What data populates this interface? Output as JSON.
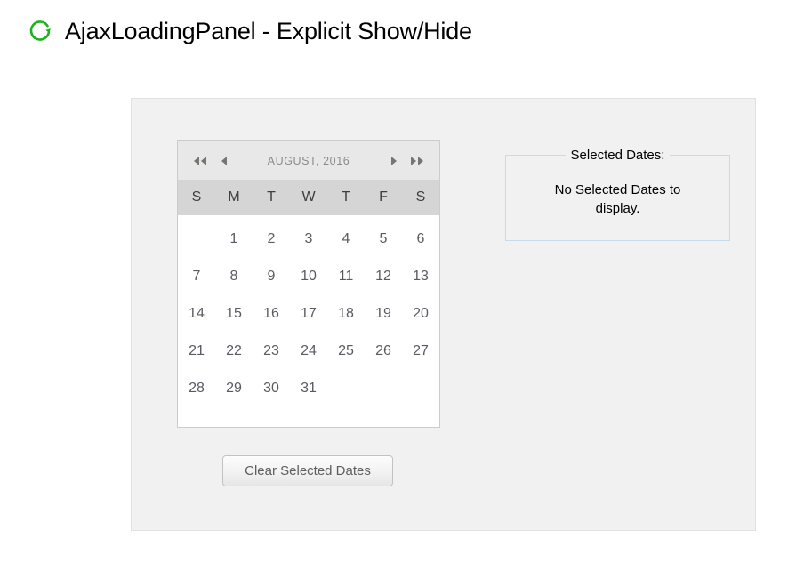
{
  "page": {
    "title": "AjaxLoadingPanel - Explicit Show/Hide",
    "title_icon": "refresh-loading-icon",
    "accent_color": "#1db31d",
    "background_color": "#ffffff"
  },
  "panel": {
    "background_color": "#f1f1f1",
    "border_color": "#e2e2e2"
  },
  "calendar": {
    "title": "AUGUST, 2016",
    "month": "AUGUST",
    "year": "2016",
    "nav": {
      "fast_prev": "◀◀",
      "prev": "◀",
      "next": "▶",
      "fast_next": "▶▶",
      "fast_prev_name": "previous-year",
      "prev_name": "previous-month",
      "next_name": "next-month",
      "fast_next_name": "next-year"
    },
    "day_names": [
      "S",
      "M",
      "T",
      "W",
      "T",
      "F",
      "S"
    ],
    "weeks": [
      [
        "",
        "1",
        "2",
        "3",
        "4",
        "5",
        "6"
      ],
      [
        "7",
        "8",
        "9",
        "10",
        "11",
        "12",
        "13"
      ],
      [
        "14",
        "15",
        "16",
        "17",
        "18",
        "19",
        "20"
      ],
      [
        "21",
        "22",
        "23",
        "24",
        "25",
        "26",
        "27"
      ],
      [
        "28",
        "29",
        "30",
        "31",
        "",
        "",
        ""
      ]
    ],
    "header_bg": "#e8e8e8",
    "daynames_bg": "#d5d5d5",
    "body_bg": "#ffffff",
    "border_color": "#cccccc",
    "title_color": "#8b8b8b",
    "date_color": "#5a5a64"
  },
  "clear_button": {
    "label": "Clear Selected Dates"
  },
  "selected_dates": {
    "legend": "Selected Dates:",
    "message": "No Selected Dates to display.",
    "border_color": "#c4dcee"
  }
}
